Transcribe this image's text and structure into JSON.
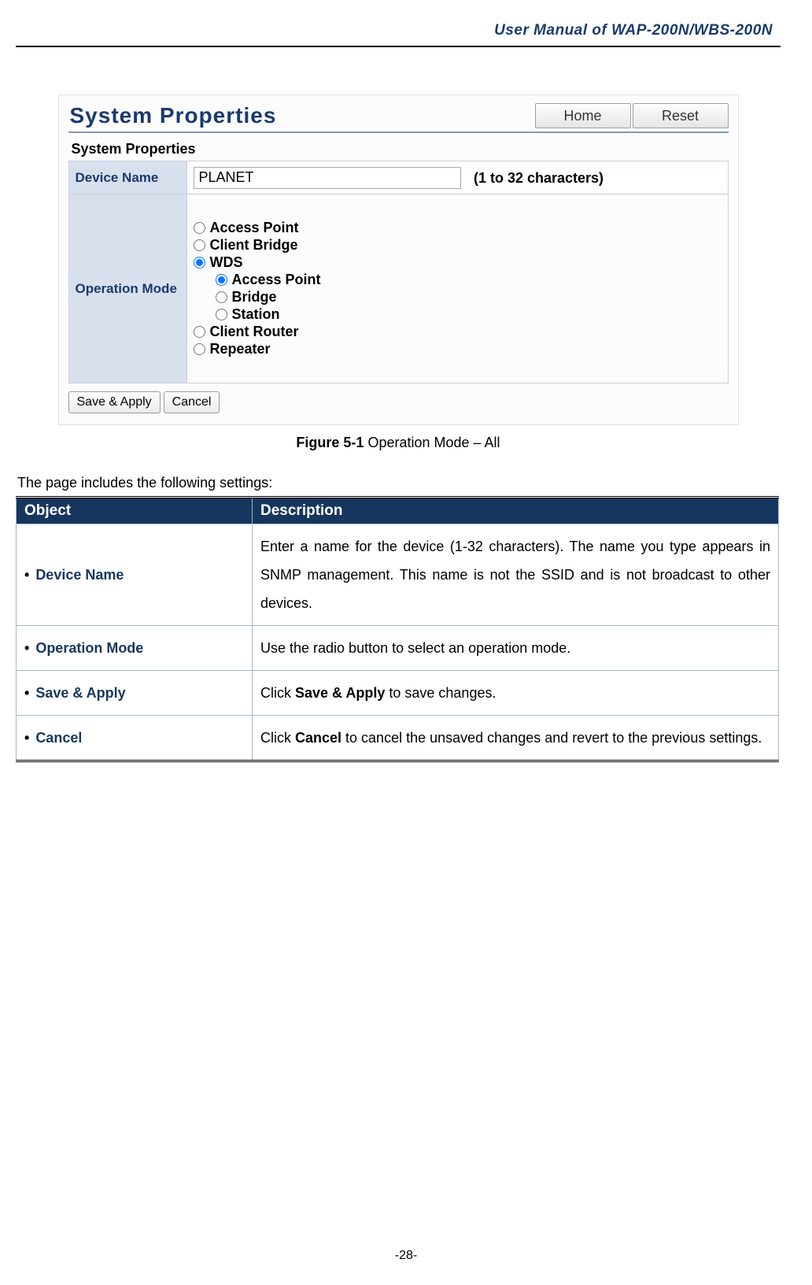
{
  "header": {
    "manual_title": "User Manual of WAP-200N/WBS-200N"
  },
  "screenshot": {
    "title": "System Properties",
    "buttons": {
      "home": "Home",
      "reset": "Reset"
    },
    "section_label": "System Properties",
    "device_name_label": "Device Name",
    "device_name_value": "PLANET",
    "device_name_note": "(1 to 32 characters)",
    "operation_mode_label": "Operation Mode",
    "modes": {
      "access_point": "Access Point",
      "client_bridge": "Client Bridge",
      "wds": "WDS",
      "wds_ap": "Access Point",
      "wds_bridge": "Bridge",
      "wds_station": "Station",
      "client_router": "Client Router",
      "repeater": "Repeater"
    },
    "action_save": "Save & Apply",
    "action_cancel": "Cancel"
  },
  "figure": {
    "label": "Figure 5-1",
    "text": " Operation Mode – All"
  },
  "intro": "The page includes the following settings:",
  "table": {
    "h_object": "Object",
    "h_description": "Description",
    "rows": [
      {
        "object": "Device Name",
        "desc_prefix": "Enter a name for the device (1-32 characters). The name you type appears in SNMP management. This name is not the SSID and is not broadcast to other devices.",
        "desc_bold": "",
        "desc_suffix": ""
      },
      {
        "object": "Operation Mode",
        "desc_prefix": "Use the radio button to select an operation mode.",
        "desc_bold": "",
        "desc_suffix": ""
      },
      {
        "object": "Save & Apply",
        "desc_prefix": "Click ",
        "desc_bold": "Save & Apply",
        "desc_suffix": " to save changes."
      },
      {
        "object": "Cancel",
        "desc_prefix": "Click ",
        "desc_bold": "Cancel",
        "desc_suffix": " to cancel the unsaved changes and revert to the previous settings."
      }
    ]
  },
  "page_number": "-28-"
}
